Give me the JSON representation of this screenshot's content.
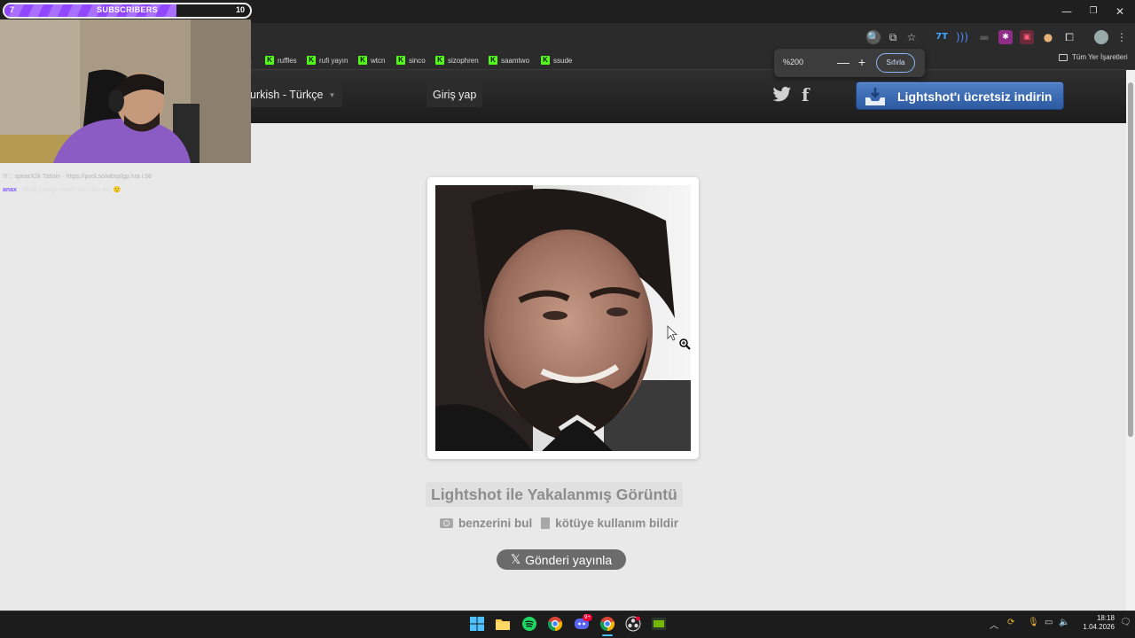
{
  "stream": {
    "subscribers": {
      "current": "7",
      "label": "SUBSCRIBERS",
      "goal": "10",
      "progress": 0.7
    },
    "chat": [
      {
        "user": "",
        "text": "!!! :: spearX2k Tahsin · https://pool.so/wbsplgp.hra i.98"
      },
      {
        "user": "anax",
        "text": ": ofkak (hellgin uzun nasıl olur ab) 🙂"
      }
    ]
  },
  "browser": {
    "window_controls": {
      "minimize": "—",
      "maximize": "❐",
      "close": "✕"
    },
    "bookmarks": [
      {
        "label": "ruffles",
        "icon": "kick-icon"
      },
      {
        "label": "rufi yayın",
        "icon": "kick-icon"
      },
      {
        "label": "wtcn",
        "icon": "kick-icon"
      },
      {
        "label": "sinco",
        "icon": "kick-icon"
      },
      {
        "label": "sizophren",
        "icon": "kick-icon"
      },
      {
        "label": "saamtwo",
        "icon": "kick-icon"
      },
      {
        "label": "ssude",
        "icon": "kick-icon"
      }
    ],
    "all_bookmarks": "Tüm Yer İşaretleri",
    "zoom": {
      "level": "%200",
      "minus": "—",
      "plus": "+",
      "reset": "Sıfırla"
    }
  },
  "site": {
    "language": "urkish - Türkçe",
    "login": "Giriş yap",
    "download_button": "Lightshot'ı ücretsiz indirin",
    "caption": "Lightshot ile Yakalanmış Görüntü",
    "actions": {
      "find_similar": "benzerini bul",
      "report": "kötüye kullanım bildir"
    },
    "post_button": "Gönderi yayınla",
    "colors": {
      "download_blue": "#3a6bb5",
      "header_dark": "#1c1c1c",
      "page_bg": "#e9e9e9"
    }
  },
  "taskbar": {
    "apps": [
      "windows-start-icon",
      "file-explorer-icon",
      "spotify-icon",
      "chrome-icon",
      "discord-icon",
      "chrome-active-icon",
      "obs-icon",
      "nvidia-icon"
    ],
    "discord_badge": "9+",
    "clock": {
      "time": "18:18",
      "date": "1.04.2026"
    }
  }
}
